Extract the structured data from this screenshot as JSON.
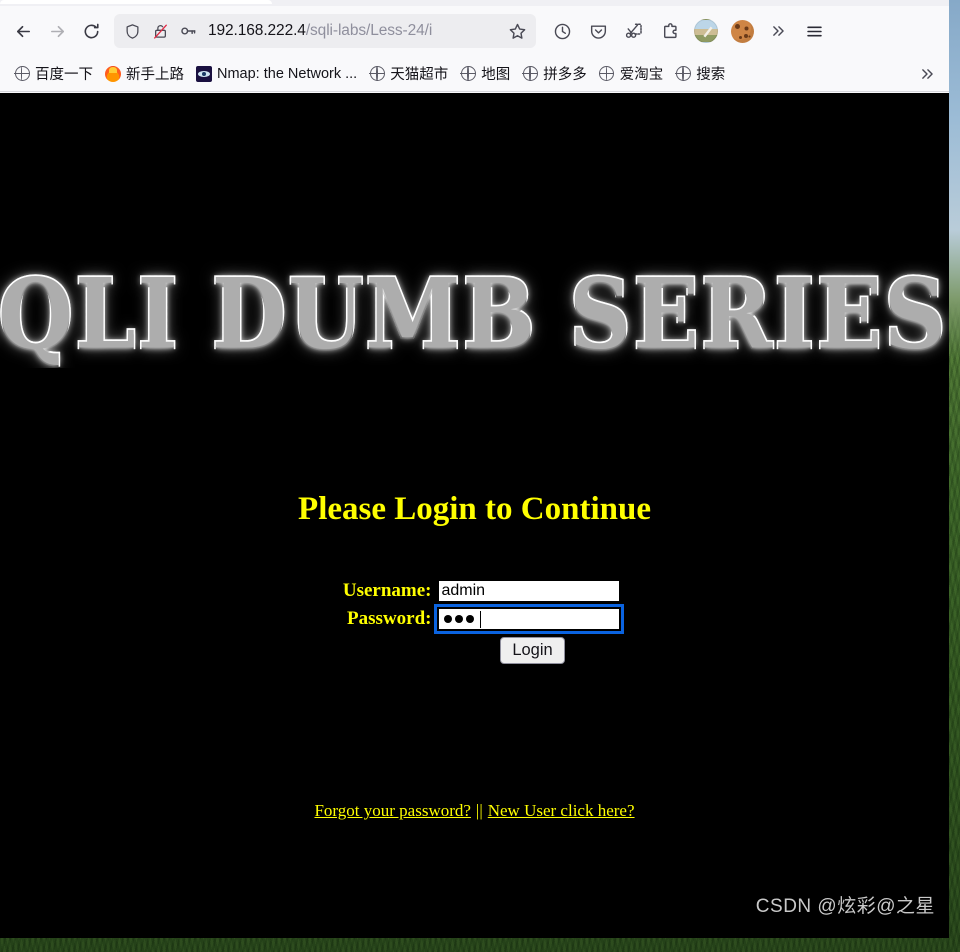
{
  "browser": {
    "nav": {
      "back_label": "Back",
      "forward_label": "Forward",
      "reload_label": "Reload"
    },
    "urlbar": {
      "shield_label": "Tracking protection",
      "lock_label": "Connection not secure",
      "key_label": "Saved logins",
      "url_host": "192.168.222.4",
      "url_path": "/sqli-labs/Less-24/i",
      "url_full": "192.168.222.4/sqli-labs/Less-24/i",
      "bookmark_label": "Bookmark this page"
    },
    "toolbar_right": [
      {
        "name": "history-icon",
        "label": "History"
      },
      {
        "name": "pocket-icon",
        "label": "Save to Pocket"
      },
      {
        "name": "screenshot-icon",
        "label": "Take Screenshot"
      },
      {
        "name": "extensions-icon",
        "label": "Extensions"
      },
      {
        "name": "account-avatar",
        "label": "Account"
      },
      {
        "name": "cookie-icon",
        "label": "Cookie Manager"
      },
      {
        "name": "overflow-icon",
        "label": "More tools"
      },
      {
        "name": "app-menu-icon",
        "label": "Open application menu"
      }
    ],
    "bookmarks": [
      {
        "label": "百度一下",
        "favicon": "globe-icon"
      },
      {
        "label": "新手上路",
        "favicon": "firefox-icon"
      },
      {
        "label": "Nmap: the Network ...",
        "favicon": "nmap-icon"
      },
      {
        "label": "天猫超市",
        "favicon": "globe-icon"
      },
      {
        "label": "地图",
        "favicon": "globe-icon"
      },
      {
        "label": "拼多多",
        "favicon": "globe-icon"
      },
      {
        "label": "爱淘宝",
        "favicon": "globe-icon"
      },
      {
        "label": "搜索",
        "favicon": "globe-icon"
      }
    ],
    "bookmarks_overflow_label": "»"
  },
  "page": {
    "banner_text": "SQLI DUMB SERIES-",
    "title": "Please Login to Continue",
    "form": {
      "username_label": "Username:",
      "username_value": "admin",
      "username_placeholder": "",
      "password_label": "Password:",
      "password_value": "•••",
      "password_masked_count": 3,
      "password_placeholder": "",
      "submit_label": "Login"
    },
    "links": {
      "forgot": "Forgot your password?",
      "separator": "||",
      "new_user": "New User click here?"
    },
    "background_color": "#000000",
    "accent_color": "#ffff00",
    "focus_ring_color": "#0a63e0"
  },
  "watermark": "CSDN @炫彩@之星"
}
